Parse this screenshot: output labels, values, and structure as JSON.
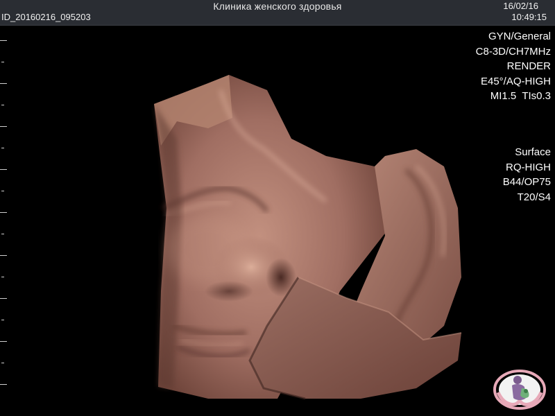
{
  "header": {
    "clinic_name": "Клиника женского здоровья",
    "patient_id": "ID_20160216_095203",
    "date": "16/02/16",
    "time": "10:49:15"
  },
  "scan_params": {
    "preset": "GYN/General",
    "probe": "C8-3D/CH7MHz",
    "mode": "RENDER",
    "angle_quality": "E45°/AQ-HIGH",
    "mi_tis": "MI1.5  TIs0.3"
  },
  "render_params": {
    "surface": "Surface",
    "rq": "RQ-HIGH",
    "b_op": "B44/OP75",
    "t_s": "T20/S4"
  },
  "image": {
    "subject": "3D ultrasound surface render of fetal face",
    "skin_color": "#a9776b",
    "background": "#000000"
  },
  "icons": {
    "logo": "clinic-logo-icon"
  }
}
